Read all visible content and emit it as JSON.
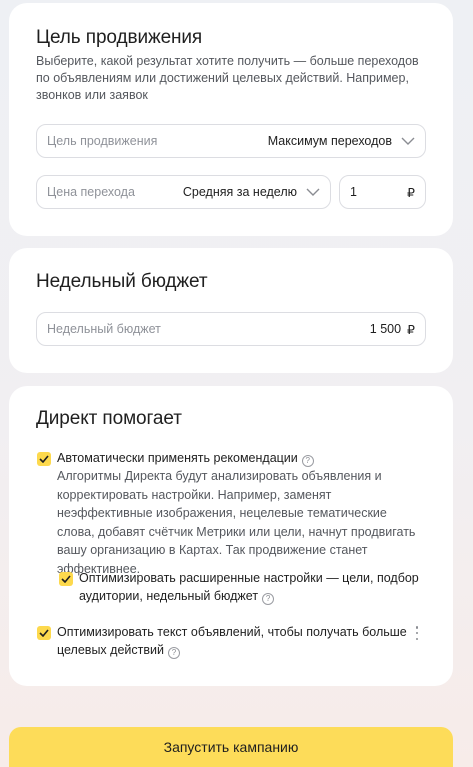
{
  "goal_card": {
    "title": "Цель продвижения",
    "description": "Выберите, какой результат хотите получить — больше переходов по объявлениям или достижений целевых действий. Например, звонков или заявок",
    "goal_select": {
      "placeholder": "Цель продвижения",
      "value": "Максимум переходов"
    },
    "price_select": {
      "placeholder": "Цена перехода",
      "value": "Средняя за неделю"
    },
    "price_input": {
      "value": "1",
      "currency": "₽"
    }
  },
  "budget_card": {
    "title": "Недельный бюджет",
    "budget_field": {
      "placeholder": "Недельный бюджет",
      "value": "1 500",
      "currency": "₽"
    }
  },
  "helps_card": {
    "title": "Директ помогает",
    "options": [
      {
        "label": "Автоматически применять рекомендации",
        "checked": true,
        "description": "Алгоритмы Директа будут анализировать объявления и корректировать настройки. Например, заменят неэффективные изображения, нецелевые тематические слова, добавят счётчик Метрики или цели, начнут продвигать вашу организацию в Картах. Так продвижение станет эффективнее."
      },
      {
        "label": "Оптимизировать расширенные настройки — цели, подбор аудитории, недельный бюджет",
        "checked": true
      },
      {
        "label": "Оптимизировать текст объявлений, чтобы получать больше целевых действий",
        "checked": true
      }
    ]
  },
  "launch_button": {
    "label": "Запустить кампанию"
  },
  "colors": {
    "accent": "#fddc59",
    "check": "#fdd94d",
    "card": "#ffffff"
  }
}
